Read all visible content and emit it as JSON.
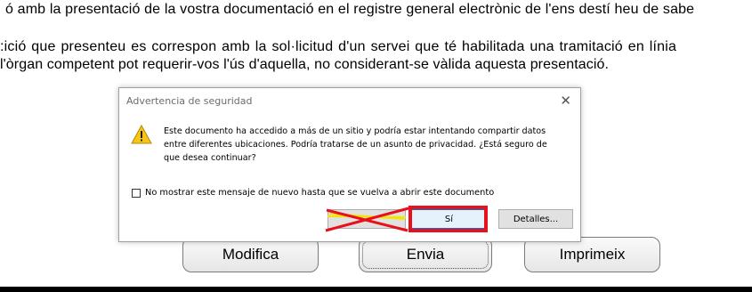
{
  "document": {
    "line1": "ó amb la presentació de la vostra documentació en el registre general electrònic de l'ens destí heu de sabe",
    "line2": ":ició que presenteu es correspon amb la sol·licitud d'un servei que té habilitada una tramitació en línia",
    "line3": "l'òrgan competent pot requerir-vos l'ús d'aquella, no considerant-se vàlida aquesta presentació."
  },
  "page_buttons": {
    "modifica": "Modifica",
    "envia": "Envia",
    "imprimeix": "Imprimeix"
  },
  "dialog": {
    "title": "Advertencia de seguridad",
    "close_glyph": "✕",
    "message": "Este documento ha accedido a más de un sitio y podría estar intentando compartir datos entre diferentes ubicaciones. Podría tratarse de un asunto de privacidad. ¿Está seguro de que desea continuar?",
    "checkbox_label": "No mostrar este mensaje de nuevo hasta que se vuelva a abrir este documento",
    "checkbox_checked": false,
    "yes_label": "Sí",
    "details_label": "Detalles...",
    "icon": "warning-triangle-icon"
  },
  "annotations": {
    "highlight_color": "#e8101a",
    "strike_color": "#e8101a",
    "strike_underline_color": "#f2e600"
  }
}
